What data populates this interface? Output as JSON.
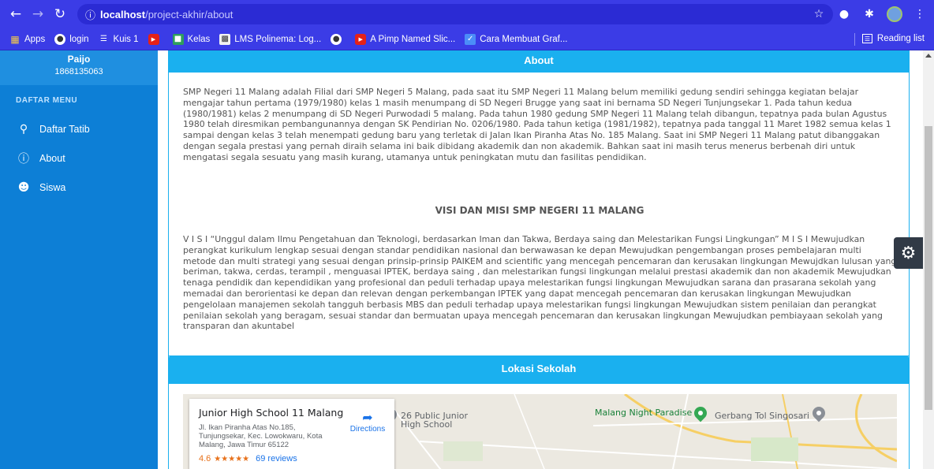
{
  "browser": {
    "url_host": "localhost",
    "url_path": "/project-akhir/about",
    "bookmarks": [
      {
        "label": "Apps",
        "icon": "apps-grid-icon"
      },
      {
        "label": "login",
        "icon": "globe-icon"
      },
      {
        "label": "Kuis 1",
        "icon": "list-icon"
      },
      {
        "label": "",
        "icon": "youtube-icon"
      },
      {
        "label": "Kelas",
        "icon": "classroom-icon"
      },
      {
        "label": "LMS Polinema: Log...",
        "icon": "lms-icon"
      },
      {
        "label": "",
        "icon": "globe-icon"
      },
      {
        "label": "A Pimp Named Slic...",
        "icon": "youtube-icon"
      },
      {
        "label": "Cara Membuat Graf...",
        "icon": "chart-icon"
      }
    ],
    "reading_list": "Reading list"
  },
  "sidebar": {
    "user_name": "Paijo",
    "user_id": "1868135063",
    "menu_header": "DAFTAR MENU",
    "items": [
      {
        "label": "Daftar Tatib",
        "icon": "user-icon"
      },
      {
        "label": "About",
        "icon": "info-icon"
      },
      {
        "label": "Siswa",
        "icon": "users-icon"
      }
    ]
  },
  "about": {
    "title": "About",
    "paragraph": "SMP Negeri 11 Malang adalah Filial dari SMP Negeri 5 Malang, pada saat itu SMP Negeri 11 Malang belum memiliki gedung sendiri sehingga kegiatan belajar mengajar tahun pertama (1979/1980) kelas 1 masih menumpang di SD Negeri Brugge yang saat ini bernama SD Negeri Tunjungsekar 1. Pada tahun kedua (1980/1981) kelas 2 menumpang di SD Negeri Purwodadi 5 malang. Pada tahun 1980 gedung SMP Negeri 11 Malang telah dibangun, tepatnya pada bulan Agustus 1980 telah diresmikan pembangunannya dengan SK Pendirian No. 0206/1980. Pada tahun ketiga (1981/1982), tepatnya pada tanggal 11 Maret 1982 semua kelas 1 sampai dengan kelas 3 telah menempati gedung baru yang terletak di Jalan Ikan Piranha Atas No. 185 Malang. Saat ini SMP Negeri 11 Malang patut dibanggakan dengan segala prestasi yang pernah diraih selama ini baik dibidang akademik dan non akademik. Bahkan saat ini masih terus menerus berbenah diri untuk mengatasi segala sesuatu yang masih kurang, utamanya untuk peningkatan mutu dan fasilitas pendidikan.",
    "visi_title": "VISI DAN MISI SMP NEGERI 11 MALANG",
    "visi_text": "V I S I “Unggul dalam Ilmu Pengetahuan dan Teknologi, berdasarkan Iman dan Takwa, Berdaya saing dan Melestarikan Fungsi Lingkungan” M I S I Mewujudkan perangkat kurikulum lengkap sesuai dengan standar pendidikan nasional dan berwawasan ke depan Mewujudkan pengembangan proses pembelajaran multi metode dan multi strategi yang sesuai dengan prinsip-prinsip PAIKEM and scientific yang mencegah pencemaran dan kerusakan lingkungan Mewujdkan lulusan yang beriman, takwa, cerdas, terampil , menguasai IPTEK, berdaya saing , dan melestarikan fungsi lingkungan melalui prestasi akademik dan non akademik Mewujudkan tenaga pendidik dan kependidikan yang profesional dan peduli terhadap upaya melestarikan fungsi lingkungan Mewujudkan sarana dan prasarana sekolah yang memadai dan berorientasi ke depan dan relevan dengan perkembangan IPTEK yang dapat mencegah pencemaran dan kerusakan lingkungan Mewujudkan pengelolaan manajemen sekolah tangguh berbasis MBS dan peduli terhadap upaya melestarikan fungsi lingkungan Mewujudkan sistem penilaian dan perangkat penilaian sekolah yang beragam, sesuai standar dan bermuatan upaya mencegah pencemaran dan kerusakan lingkungan Mewujudkan pembiayaan sekolah yang transparan dan akuntabel"
  },
  "lokasi": {
    "title": "Lokasi Sekolah",
    "place_name": "Junior High School 11 Malang",
    "address": "Jl. Ikan Piranha Atas No.185, Tunjungsekar, Kec. Lowokwaru, Kota Malang, Jawa Timur 65122",
    "rating": "4.6",
    "stars": "★★★★★",
    "reviews": "69 reviews",
    "directions": "Directions",
    "map_labels": [
      "26 Public Junior High School",
      "Malang Night Paradise",
      "Gerbang Tol Singosari"
    ]
  },
  "colors": {
    "chrome": "#3b3ce6",
    "sidebar": "#0d7fd6",
    "accent": "#1ab0ef",
    "settings": "#313a46"
  }
}
